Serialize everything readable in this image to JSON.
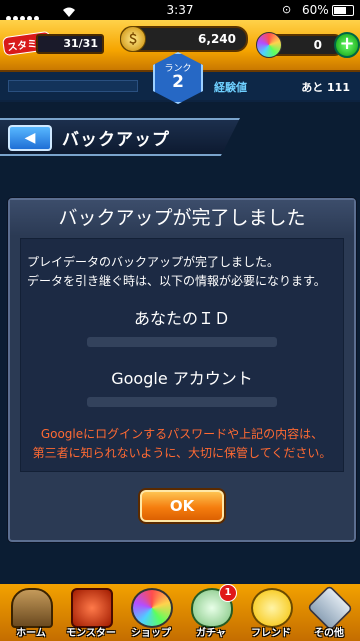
{
  "status_bar": {
    "time": "3:37",
    "battery": "60%"
  },
  "hud": {
    "stamina_label": "スタミナ",
    "stamina": "31/31",
    "gold": "6,240",
    "orbs": "0",
    "rank_label": "ランク",
    "rank": "2",
    "exp_label": "経験値",
    "exp_remaining": "あと 111"
  },
  "header": {
    "title": "バックアップ"
  },
  "dialog": {
    "title": "バックアップが完了しました",
    "message_line1": "プレイデータのバックアップが完了しました。",
    "message_line2": "データを引き継ぐ時は、以下の情報が必要になります。",
    "id_label": "あなたのＩＤ",
    "google_label": "Google アカウント",
    "warning_line1": "Googleにログインするパスワードや上記の内容は、",
    "warning_line2": "第三者に知られないように、大切に保管してください。",
    "ok_label": "OK",
    "warning_color": "#ff6a33"
  },
  "nav": {
    "items": [
      {
        "label": "ホーム",
        "icon": "home-icon"
      },
      {
        "label": "モンスター",
        "icon": "monster-icon"
      },
      {
        "label": "ショップ",
        "icon": "shop-orb-icon"
      },
      {
        "label": "ガチャ",
        "icon": "gacha-egg-icon",
        "badge": "1"
      },
      {
        "label": "フレンド",
        "icon": "friend-icon"
      },
      {
        "label": "その他",
        "icon": "other-icon"
      }
    ]
  }
}
